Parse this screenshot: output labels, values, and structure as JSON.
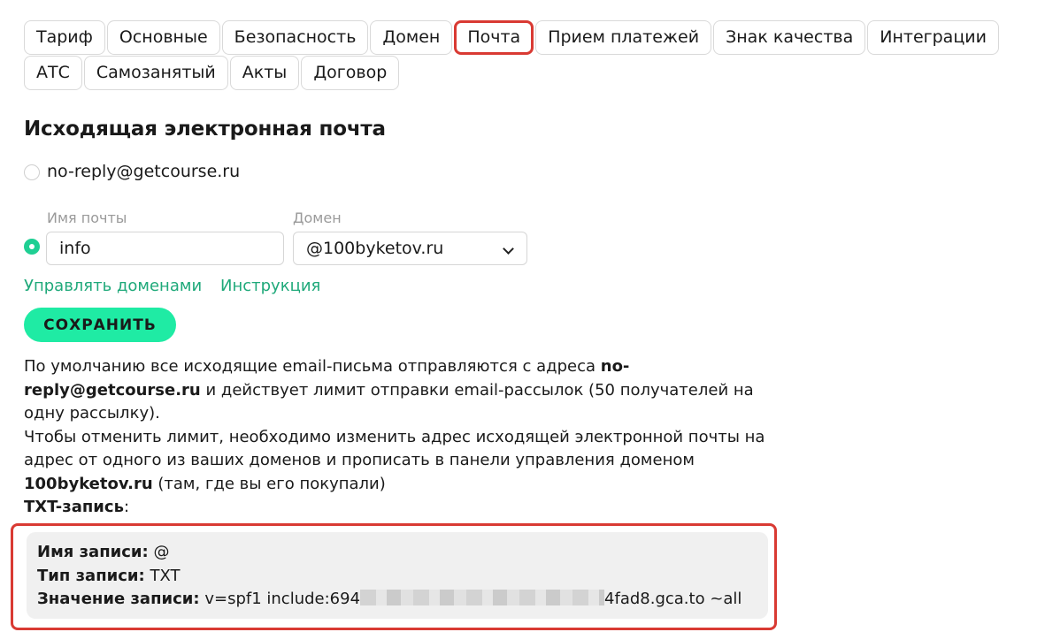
{
  "tabs_row1": [
    "Тариф",
    "Основные",
    "Безопасность",
    "Домен",
    "Почта",
    "Прием платежей",
    "Знак качества",
    "Интеграции"
  ],
  "tabs_row2": [
    "АТС",
    "Самозанятый",
    "Акты",
    "Договор"
  ],
  "active_tab": "Почта",
  "section_title": "Исходящая электронная почта",
  "option_default": "no-reply@getcourse.ru",
  "mail_name_label": "Имя почты",
  "mail_name_value": "info",
  "domain_label": "Домен",
  "domain_value": "@100byketov.ru",
  "links": {
    "manage": "Управлять доменами",
    "instruction": "Инструкция"
  },
  "save_label": "СОХРАНИТЬ",
  "info": {
    "p1a": "По умолчанию все исходящие email-письма отправляются с адреса ",
    "p1b": "no-reply@getcourse.ru",
    "p1c": " и действует лимит отправки email-рассылок (50 получателей на одну рассылку).",
    "p2a": "Чтобы отменить лимит, необходимо изменить адрес исходящей электронной почты на адрес от одного из ваших доменов и прописать в панели управления доменом ",
    "p2b": "100byketov.ru",
    "p2c": " (там, где вы его покупали)",
    "txt_label": "TXT-запись",
    "txt_colon": ":"
  },
  "record": {
    "name_label": "Имя записи:",
    "name_value": "@",
    "type_label": "Тип записи:",
    "type_value": "TXT",
    "value_label": "Значение записи:",
    "value_prefix": "v=spf1 include:694",
    "value_suffix": "4fad8.gca.to ~all"
  },
  "colors": {
    "accent": "#1feba4",
    "link": "#1fa97a",
    "highlight": "#d93a33"
  }
}
